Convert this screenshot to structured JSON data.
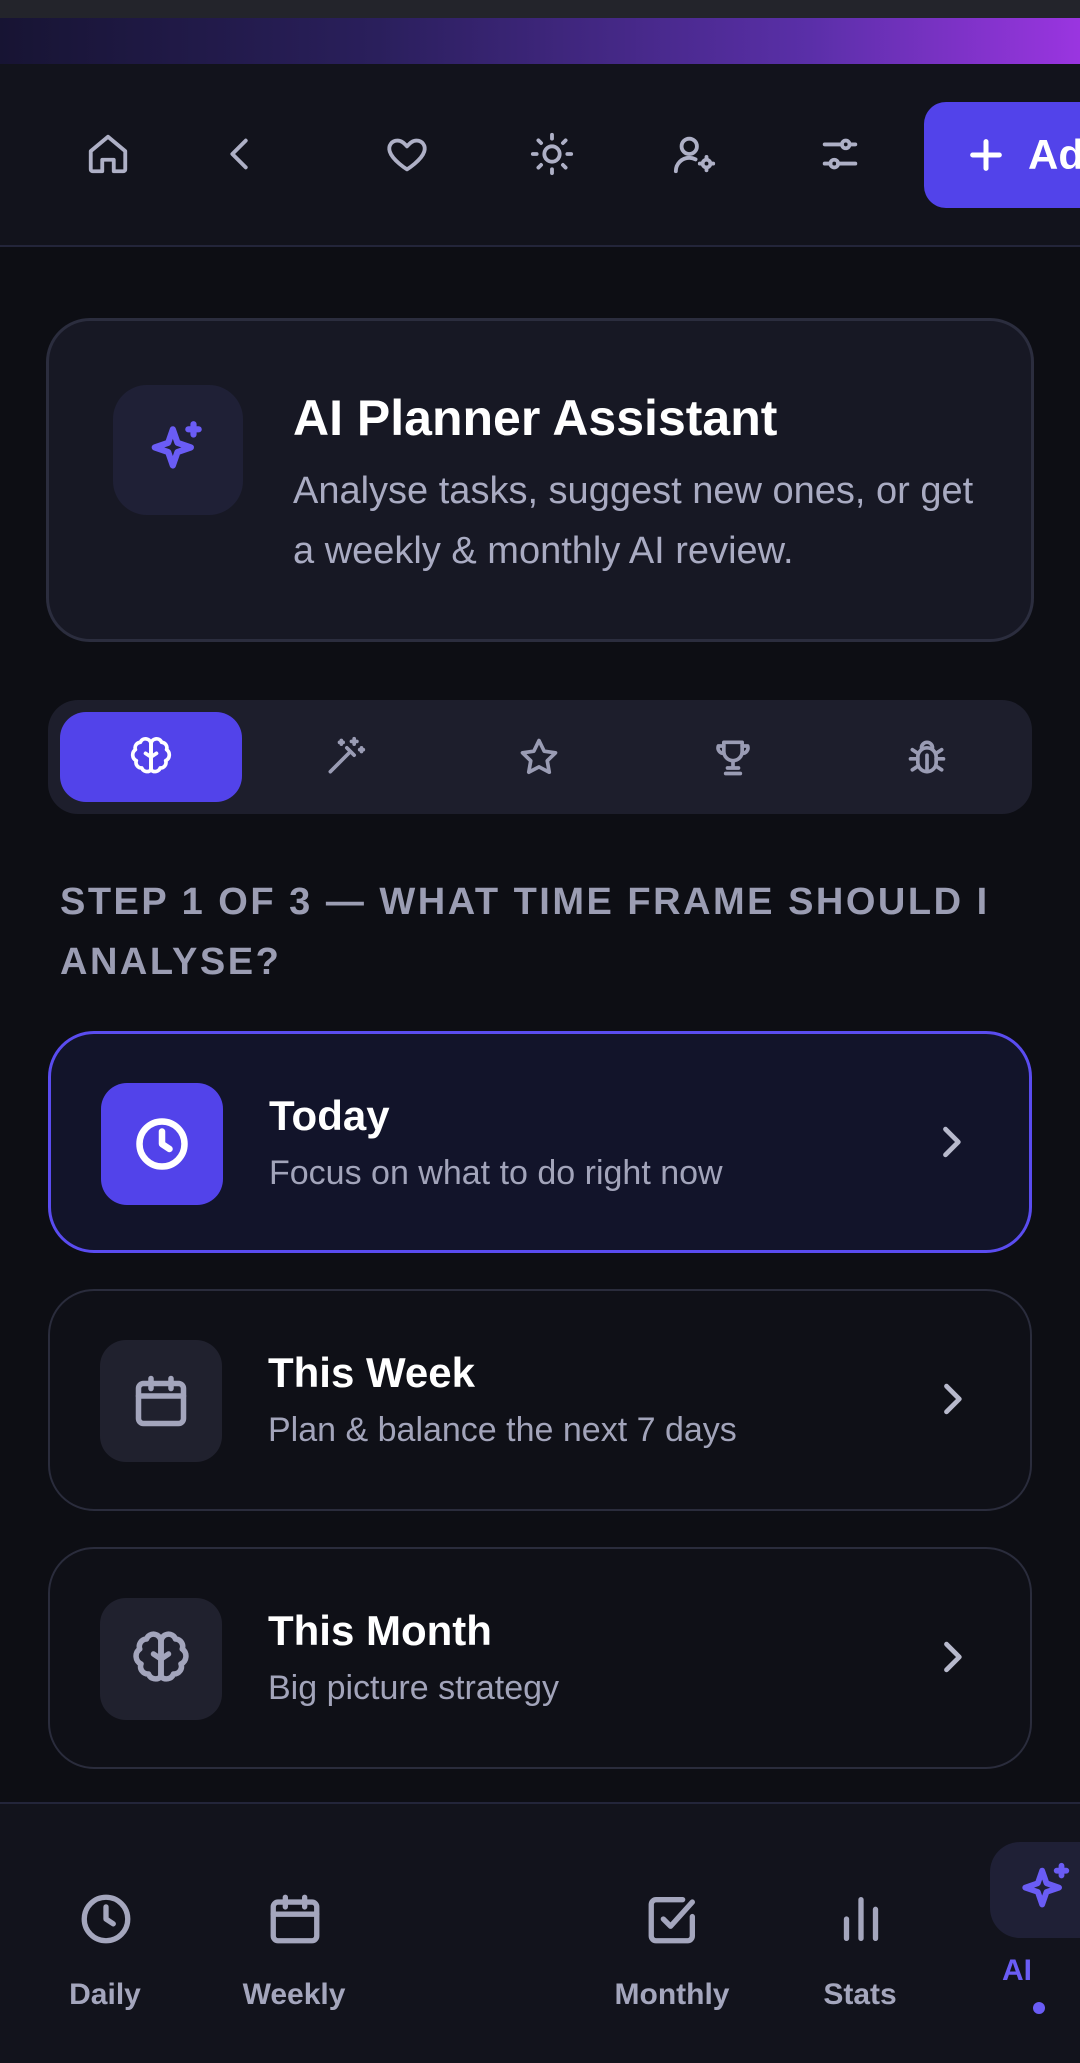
{
  "toolbar": {
    "add_label": "Add",
    "icons": [
      "home-icon",
      "chevron-left-icon",
      "heart-icon",
      "sun-icon",
      "user-gear-icon",
      "sliders-icon",
      "plus-icon"
    ]
  },
  "assistant": {
    "title": "AI Planner Assistant",
    "description": "Analyse tasks, suggest new ones, or get a weekly & monthly AI review.",
    "icon": "sparkles-icon"
  },
  "mode_tabs": {
    "active_index": 0,
    "icons": [
      "brain-icon",
      "magic-wand-icon",
      "star-icon",
      "trophy-icon",
      "bug-icon"
    ]
  },
  "step": {
    "heading": "STEP 1 OF 3 — WHAT TIME FRAME SHOULD I ANALYSE?"
  },
  "options": [
    {
      "title": "Today",
      "subtitle": "Focus on what to do right now",
      "icon": "clock-icon",
      "selected": true
    },
    {
      "title": "This Week",
      "subtitle": "Plan & balance the next 7 days",
      "icon": "calendar-icon",
      "selected": false
    },
    {
      "title": "This Month",
      "subtitle": "Big picture strategy",
      "icon": "brain-icon",
      "selected": false
    }
  ],
  "bottom_nav": {
    "items": [
      {
        "label": "Daily",
        "icon": "clock-icon"
      },
      {
        "label": "Weekly",
        "icon": "calendar-icon"
      },
      {
        "label": "Monthly",
        "icon": "checkbox-icon"
      },
      {
        "label": "Stats",
        "icon": "bar-chart-icon"
      },
      {
        "label": "AI",
        "icon": "sparkles-icon",
        "active": true
      }
    ]
  },
  "colors": {
    "accent": "#5243ea",
    "accent_text": "#6a5cf5",
    "background": "#0d0e14",
    "surface": "#171824",
    "muted_text": "#a4a6bd"
  }
}
